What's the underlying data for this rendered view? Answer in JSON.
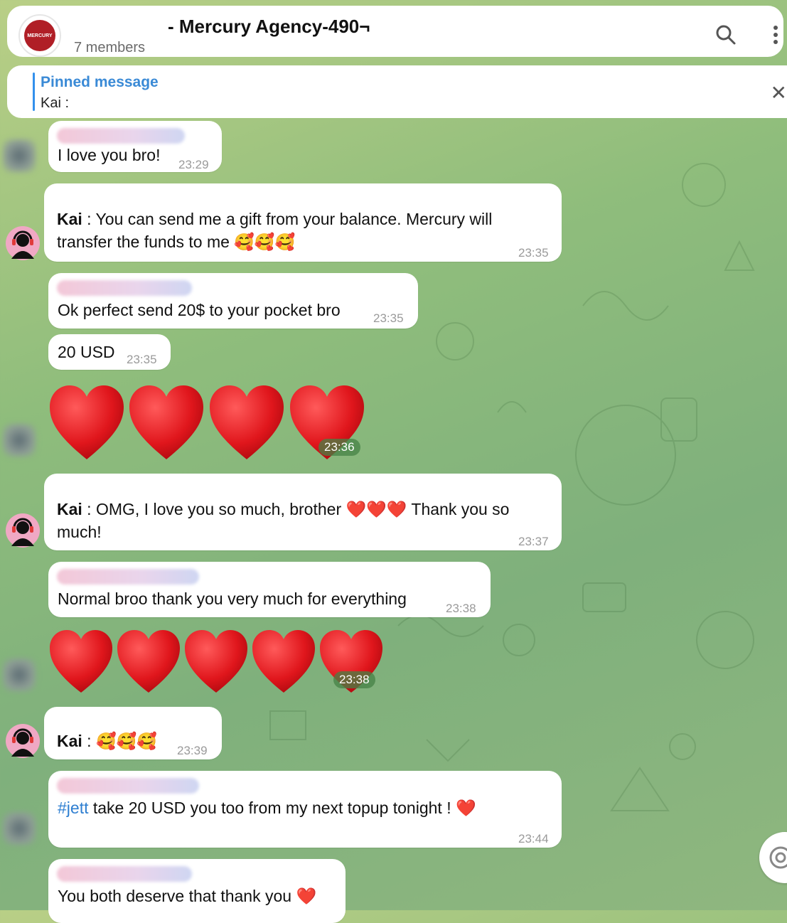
{
  "header": {
    "title": "- Mercury Agency-490¬",
    "members": "7 members",
    "logo_text": "MERCURY"
  },
  "pinned": {
    "label": "Pinned message",
    "text": "Kai :"
  },
  "messages": [
    {
      "text": "I love you bro!",
      "time": "23:29"
    },
    {
      "sender": "Kai",
      "text": " : You can send me a gift from your balance. Mercury will transfer the funds to me",
      "emoji": "🥰🥰🥰",
      "time": "23:35"
    },
    {
      "text": "Ok perfect send 20$ to your pocket bro",
      "time": "23:35"
    },
    {
      "text": "20 USD",
      "time": "23:35"
    },
    {
      "hearts": 4,
      "time": "23:36"
    },
    {
      "sender": "Kai",
      "text": " : OMG, I love you so much, brother",
      "emoji": "❤️❤️❤️",
      "text2": " Thank you so much!",
      "time": "23:37"
    },
    {
      "text": "Normal broo thank you very much for everything",
      "time": "23:38"
    },
    {
      "hearts": 5,
      "time": "23:38"
    },
    {
      "sender": "Kai",
      "text": " : ",
      "emoji": "🥰🥰🥰",
      "time": "23:39"
    },
    {
      "hashtag": "#jett",
      "text": " take 20 USD you too from my next topup tonight !",
      "emoji": "❤️",
      "time": "23:44"
    },
    {
      "text": "You both deserve that thank you",
      "emoji": "❤️"
    }
  ],
  "colors": {
    "accent": "#3390ec",
    "heart": "#e0161c",
    "bubble": "#ffffff"
  }
}
